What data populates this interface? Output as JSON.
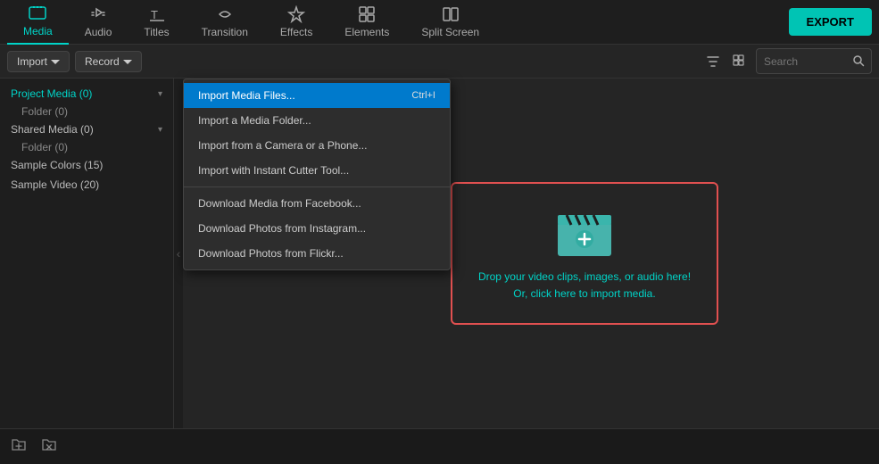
{
  "nav": {
    "items": [
      {
        "id": "media",
        "label": "Media",
        "active": true
      },
      {
        "id": "audio",
        "label": "Audio",
        "active": false
      },
      {
        "id": "titles",
        "label": "Titles",
        "active": false
      },
      {
        "id": "transition",
        "label": "Transition",
        "active": false
      },
      {
        "id": "effects",
        "label": "Effects",
        "active": false
      },
      {
        "id": "elements",
        "label": "Elements",
        "active": false
      },
      {
        "id": "split-screen",
        "label": "Split Screen",
        "active": false
      }
    ],
    "export_label": "EXPORT"
  },
  "toolbar": {
    "import_label": "Import",
    "record_label": "Record",
    "search_placeholder": "Search"
  },
  "sidebar": {
    "items": [
      {
        "id": "project-media",
        "label": "Project Media (0)",
        "active": true,
        "has_arrow": true
      },
      {
        "id": "folder",
        "label": "Folder (0)",
        "sub": true
      },
      {
        "id": "shared-media",
        "label": "Shared Media (0)",
        "has_arrow": true
      },
      {
        "id": "folder2",
        "label": "Folder (0)",
        "sub": true
      },
      {
        "id": "sample-colors",
        "label": "Sample Colors (15)"
      },
      {
        "id": "sample-video",
        "label": "Sample Video (20)"
      }
    ]
  },
  "dropdown": {
    "items": [
      {
        "id": "import-files",
        "label": "Import Media Files...",
        "shortcut": "Ctrl+I",
        "highlighted": true
      },
      {
        "id": "import-folder",
        "label": "Import a Media Folder...",
        "shortcut": ""
      },
      {
        "id": "import-camera",
        "label": "Import from a Camera or a Phone...",
        "shortcut": ""
      },
      {
        "id": "import-cutter",
        "label": "Import with Instant Cutter Tool...",
        "shortcut": ""
      },
      {
        "id": "download-facebook",
        "label": "Download Media from Facebook...",
        "shortcut": ""
      },
      {
        "id": "download-instagram",
        "label": "Download Photos from Instagram...",
        "shortcut": ""
      },
      {
        "id": "download-flickr",
        "label": "Download Photos from Flickr...",
        "shortcut": ""
      }
    ]
  },
  "dropzone": {
    "line1": "Drop your video clips, images, or audio here!",
    "line2": "Or, click here to import media."
  },
  "colors": {
    "accent": "#00d4c8",
    "highlight": "#007acc",
    "border_red": "#e05050"
  }
}
